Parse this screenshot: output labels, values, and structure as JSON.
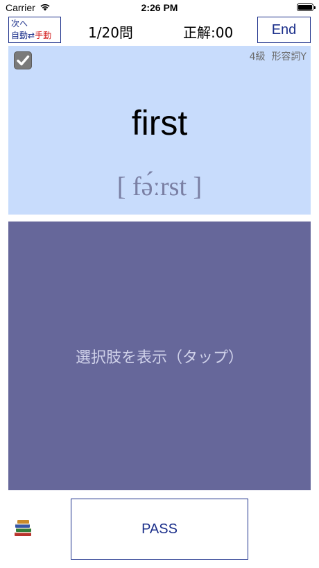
{
  "status_bar": {
    "carrier": "Carrier",
    "time": "2:26 PM"
  },
  "header": {
    "mode_button": {
      "line1": "次へ",
      "auto": "自動",
      "arrows": "⇄",
      "manual": "手動"
    },
    "counter": "1/20問",
    "score": "正解:00",
    "end_label": "End"
  },
  "card": {
    "checked": true,
    "level": "4級",
    "part_of_speech": "形容詞Y",
    "word": "first",
    "pronunciation": "[ fə́ːrst ]"
  },
  "choices": {
    "prompt": "選択肢を表示（タップ）"
  },
  "footer": {
    "book_icon": "books-icon",
    "pass_label": "PASS"
  },
  "colors": {
    "accent": "#1a2e8a",
    "manual_red": "#d21e1e",
    "card_bg": "#c8dcfc",
    "choices_bg": "#66679a"
  }
}
